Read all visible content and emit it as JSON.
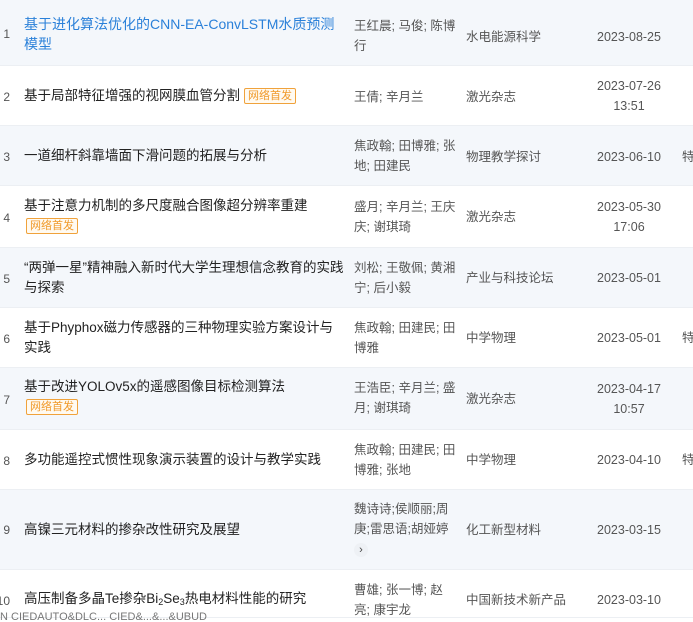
{
  "rows": [
    {
      "num": "1",
      "title": "基于进化算法优化的CNN-EA-ConvLSTM水质预测模型",
      "badge": "",
      "authors": "王红晨; 马俊; 陈博行",
      "source": "水电能源科学",
      "date": "2023-08-25",
      "time": "",
      "type": ""
    },
    {
      "num": "2",
      "title": "基于局部特征增强的视网膜血管分割",
      "badge": "网络首发",
      "authors": "王倩; 辛月兰",
      "source": "激光杂志",
      "date": "2023-07-26",
      "time": "13:51",
      "type": ""
    },
    {
      "num": "3",
      "title": "一道细杆斜靠墙面下滑问题的拓展与分析",
      "badge": "",
      "authors": "焦政翰; 田博雅; 张地; 田建民",
      "source": "物理教学探讨",
      "date": "2023-06-10",
      "time": "",
      "type": "特"
    },
    {
      "num": "4",
      "title": "基于注意力机制的多尺度融合图像超分辨率重建",
      "badge": "网络首发",
      "authors": "盛月; 辛月兰; 王庆庆; 谢琪琦",
      "source": "激光杂志",
      "date": "2023-05-30",
      "time": "17:06",
      "type": ""
    },
    {
      "num": "5",
      "title": "“两弹一星”精神融入新时代大学生理想信念教育的实践与探索",
      "badge": "",
      "authors": "刘松; 王敬佩; 黄湘宁; 后小毅",
      "source": "产业与科技论坛",
      "date": "2023-05-01",
      "time": "",
      "type": ""
    },
    {
      "num": "6",
      "title": "基于Phyphox磁力传感器的三种物理实验方案设计与实践",
      "badge": "",
      "authors": "焦政翰; 田建民; 田博雅",
      "source": "中学物理",
      "date": "2023-05-01",
      "time": "",
      "type": "特"
    },
    {
      "num": "7",
      "title": "基于改进YOLOv5x的遥感图像目标检测算法",
      "badge": "网络首发",
      "authors": "王浩臣; 辛月兰; 盛月; 谢琪琦",
      "source": "激光杂志",
      "date": "2023-04-17",
      "time": "10:57",
      "type": ""
    },
    {
      "num": "8",
      "title": "多功能遥控式惯性现象演示装置的设计与教学实践",
      "badge": "",
      "authors": "焦政翰; 田建民; 田博雅; 张地",
      "source": "中学物理",
      "date": "2023-04-10",
      "time": "",
      "type": "特"
    },
    {
      "num": "9",
      "title": "高镍三元材料的掺杂改性研究及展望",
      "badge": "",
      "authors": "魏诗诗;侯顺丽;周庚;雷思语;胡娅婷",
      "source": "化工新型材料",
      "date": "2023-03-15",
      "time": "",
      "type": ""
    },
    {
      "num": "10",
      "title_pre": "高压制备多晶Te掺杂Bi",
      "title_sub1": "2",
      "title_mid": "Se",
      "title_sub2": "3",
      "title_post": "热电材料性能的研究",
      "badge": "",
      "authors": "曹雄; 张一博; 赵亮; 康宇龙",
      "source": "中国新技术新产品",
      "date": "2023-03-10",
      "time": "",
      "type": ""
    }
  ],
  "expand_icon": "chevron-right-icon",
  "cutoff_text": "N   CIEDAUTO&DLC...  CIED&...&...&UBUD"
}
